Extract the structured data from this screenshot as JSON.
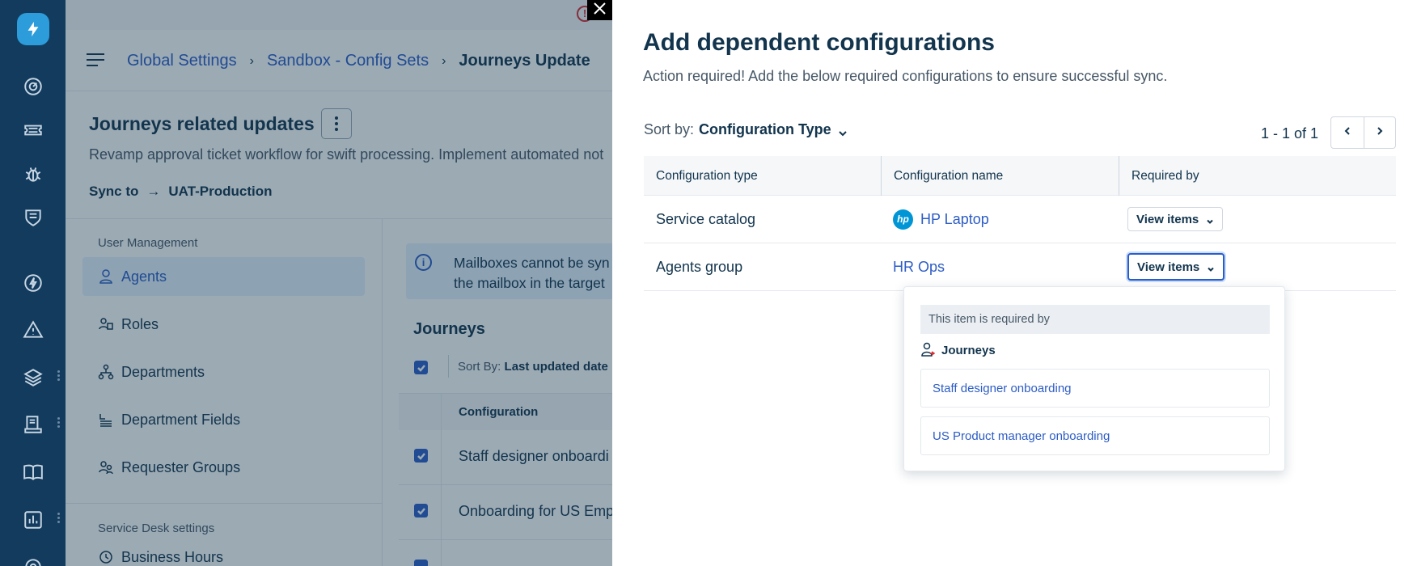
{
  "rail": {
    "icons": [
      "lightning-logo-icon",
      "dashboard-icon",
      "ticket-icon",
      "bug-icon",
      "shield-icon",
      "bolt-icon",
      "alert-icon",
      "layers-icon",
      "device-icon",
      "book-icon",
      "chart-icon",
      "gear-icon"
    ]
  },
  "header": {
    "breadcrumbs": [
      "Global Settings",
      "Sandbox - Config Sets",
      "Journeys Update"
    ]
  },
  "config_set": {
    "title": "Journeys related updates",
    "description": "Revamp approval ticket workflow for swift processing. Implement automated not",
    "sync_label": "Sync to",
    "sync_target": "UAT-Production"
  },
  "leftnav": {
    "section1": "User Management",
    "items": [
      {
        "label": "Agents",
        "icon": "person-icon",
        "active": true
      },
      {
        "label": "Roles",
        "icon": "roles-icon"
      },
      {
        "label": "Departments",
        "icon": "org-chart-icon"
      },
      {
        "label": "Department Fields",
        "icon": "fields-icon"
      },
      {
        "label": "Requester Groups",
        "icon": "group-icon"
      }
    ],
    "section2": "Service Desk settings",
    "item_business_hours": "Business Hours"
  },
  "content": {
    "banner_line1": "Mailboxes cannot be syn",
    "banner_line2": "the mailbox in the target",
    "heading": "Journeys",
    "sort_label": "Sort By:",
    "sort_value": "Last updated date",
    "column_header": "Configuration",
    "rows": [
      "Staff designer onboardi",
      "Onboarding for US Emp"
    ]
  },
  "drawer": {
    "title": "Add dependent configurations",
    "subtitle": "Action required! Add the below required configurations to ensure successful sync.",
    "sort_label": "Sort by:",
    "sort_value": "Configuration Type",
    "page_count": "1 - 1 of 1",
    "columns": [
      "Configuration type",
      "Configuration name",
      "Required by"
    ],
    "rows": [
      {
        "type": "Service catalog",
        "name": "HP Laptop",
        "icon": "hp-logo-icon",
        "button": "View items"
      },
      {
        "type": "Agents group",
        "name": "HR Ops",
        "button": "View items"
      }
    ]
  },
  "popover": {
    "header": "This item is required by",
    "module": "Journeys",
    "items": [
      "Staff designer onboarding",
      "US Product manager onboarding"
    ]
  },
  "colors": {
    "accent": "#2c5cc5",
    "rail": "#123b5e",
    "text": "#12344d",
    "hp_blue": "#0096d6"
  }
}
